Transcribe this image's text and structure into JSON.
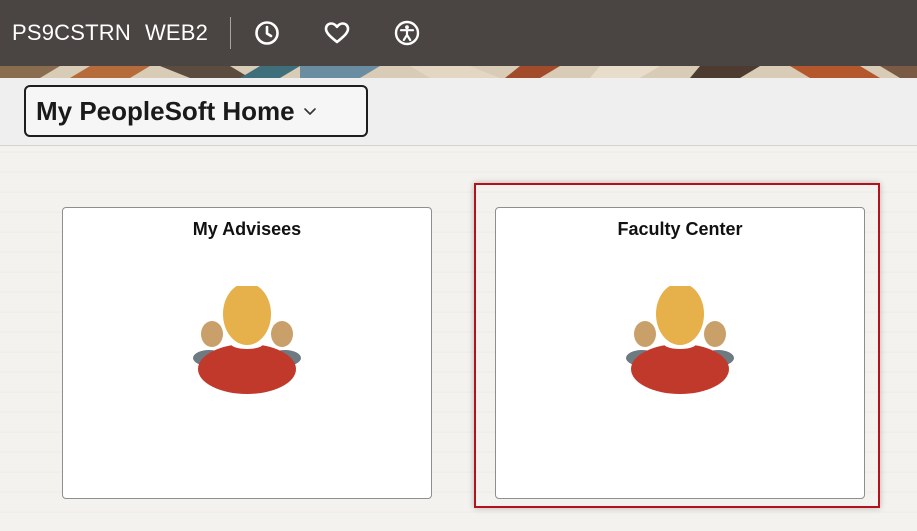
{
  "header": {
    "database": "PS9CSTRN",
    "node": "WEB2",
    "icons": [
      "clock-icon",
      "heart-icon",
      "accessibility-icon"
    ],
    "background_color": "#4a4443"
  },
  "titlebar": {
    "home_label": "My PeopleSoft Home"
  },
  "tiles": [
    {
      "title": "My Advisees",
      "icon": "people-group-icon"
    },
    {
      "title": "Faculty Center",
      "icon": "people-group-icon"
    }
  ],
  "colors": {
    "focus_ring": "#b3121c",
    "person_head": "#e6b04a",
    "person_body": "#c0392b",
    "side_head": "#c9a06a",
    "side_body": "#6e7a82"
  }
}
